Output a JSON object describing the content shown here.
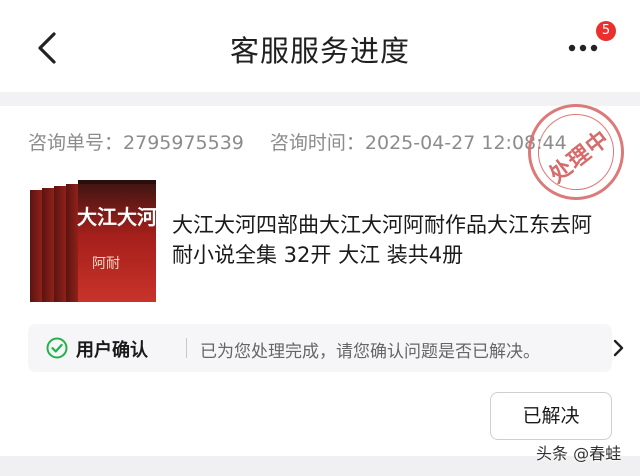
{
  "header": {
    "title": "客服服务进度",
    "badge_count": "5"
  },
  "ticket": {
    "number_label": "咨询单号：",
    "number_value": "2795975539",
    "time_label": "咨询时间：",
    "time_value": "2025-04-27 12:08:44",
    "stamp_text": "处理中"
  },
  "product": {
    "title": "大江大河四部曲大江大河阿耐作品大江东去阿耐小说全集 32开 大江 装共4册",
    "cover_text": "大江大河",
    "cover_author": "阿耐",
    "cover_color": "#b82420"
  },
  "confirm": {
    "label": "用户确认",
    "message": "已为您处理完成，请您确认问题是否已解决。",
    "check_color": "#23b14d"
  },
  "actions": {
    "resolved_label": "已解决"
  },
  "watermark": {
    "text": "头条 @春蛙"
  },
  "icons": {
    "back": "chevron-left-icon",
    "more": "ellipsis-icon",
    "check": "check-circle-icon",
    "forward": "chevron-right-icon"
  }
}
